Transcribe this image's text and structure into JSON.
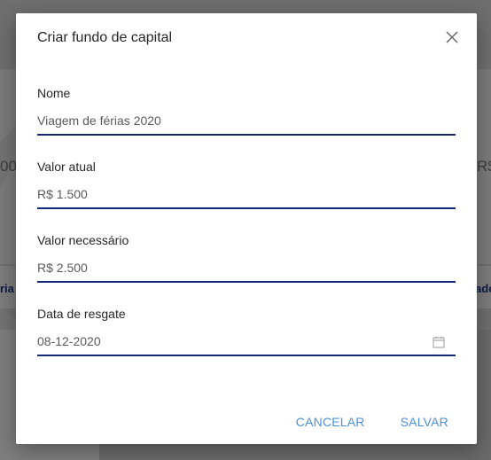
{
  "background": {
    "value_left": "00",
    "value_right": "R$",
    "tab_left": "ria",
    "tab_right": "ado"
  },
  "dialog": {
    "title": "Criar fundo de capital",
    "close_icon": "close-icon",
    "fields": {
      "name": {
        "label": "Nome",
        "value": "Viagem de férias 2020"
      },
      "current_value": {
        "label": "Valor atual",
        "value": "R$ 1.500"
      },
      "required_value": {
        "label": "Valor necessário",
        "value": "R$ 2.500"
      },
      "redeem_date": {
        "label": "Data de resgate",
        "value": "08-12-2020",
        "icon": "calendar-icon"
      }
    },
    "actions": {
      "cancel": "CANCELAR",
      "save": "SALVAR"
    }
  },
  "colors": {
    "accent_underline": "#14287a",
    "action_text": "#4a8fe0",
    "overlay": "#6f6f6f"
  }
}
